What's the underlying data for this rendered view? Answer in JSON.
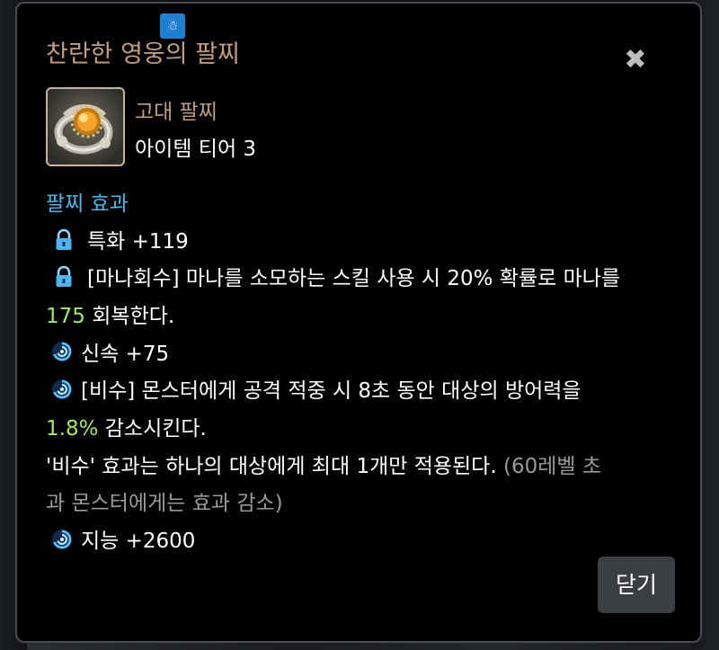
{
  "dialog": {
    "title": "찬란한 영웅의 팔찌",
    "close_icon": "close-icon",
    "close_glyph": "✖",
    "badge_glyph": "☃"
  },
  "item": {
    "thumbnail_icon": "bracelet-icon",
    "grade": "고대 팔찌",
    "tier": "아이템 티어 3"
  },
  "effects": {
    "heading": "팔찌 효과",
    "lines": [
      {
        "icon": "lock-icon",
        "text": "특화 +119"
      },
      {
        "icon": "lock-icon",
        "text": "[마나회수] 마나를 소모하는 스킬 사용 시 20% 확률로 마나를"
      },
      {
        "value": "175",
        "text": " 회복한다."
      },
      {
        "icon": "swirl-icon",
        "text": "신속 +75"
      },
      {
        "icon": "swirl-icon",
        "text": "[비수] 몬스터에게 공격 적중 시 8초 동안 대상의 방어력을"
      },
      {
        "value": "1.8%",
        "text": " 감소시킨다."
      },
      {
        "text": "'비수' 효과는 하나의 대상에게 최대 1개만 적용된다. ",
        "note": "(60레벨 초"
      },
      {
        "note": "과 몬스터에게는 효과 감소)"
      },
      {
        "icon": "swirl-icon",
        "text": "지능 +2600"
      }
    ]
  },
  "footer": {
    "close_label": "닫기"
  },
  "colors": {
    "title": "#c09c82",
    "heading": "#47b7ea",
    "highlight": "#a4e66c",
    "note": "#9a9a9a"
  }
}
